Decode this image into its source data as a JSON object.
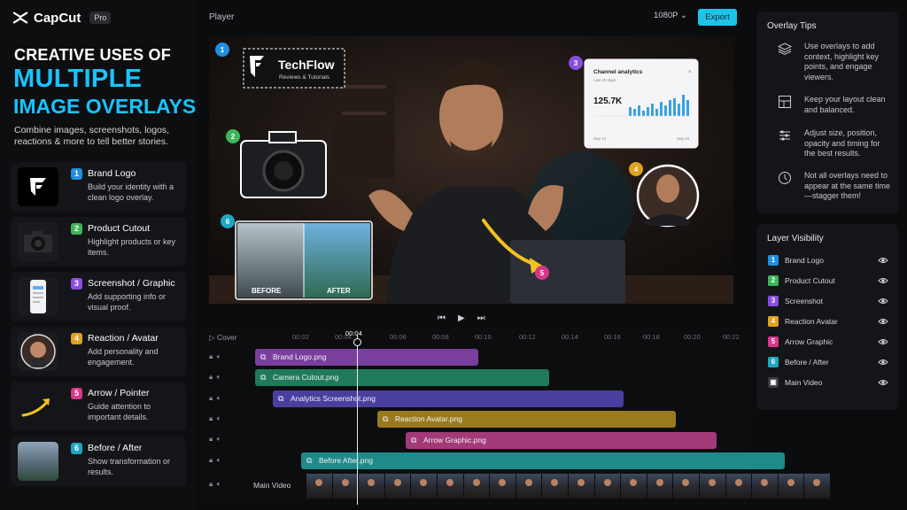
{
  "brand": {
    "name": "CapCut",
    "badge": "Pro"
  },
  "headline": {
    "line1": "CREATIVE USES OF",
    "line2": "MULTIPLE",
    "line3": "IMAGE OVERLAYS",
    "subtitle": "Combine images, screenshots, logos, reactions & more to tell better stories."
  },
  "features": [
    {
      "num": "1",
      "title": "Brand Logo",
      "desc": "Build your identity with a clean logo overlay.",
      "color": "#1f8fe0"
    },
    {
      "num": "2",
      "title": "Product Cutout",
      "desc": "Highlight products or key items.",
      "color": "#3fb55a"
    },
    {
      "num": "3",
      "title": "Screenshot / Graphic",
      "desc": "Add supporting info or visual proof.",
      "color": "#8a4fe0"
    },
    {
      "num": "4",
      "title": "Reaction / Avatar",
      "desc": "Add personality and engagement.",
      "color": "#e0a21f"
    },
    {
      "num": "5",
      "title": "Arrow / Pointer",
      "desc": "Guide attention to important details.",
      "color": "#d8368a"
    },
    {
      "num": "6",
      "title": "Before / After",
      "desc": "Show transformation or results.",
      "color": "#1fa7c2"
    }
  ],
  "player": {
    "label": "Player",
    "resolution": "1080P",
    "export_label": "Export"
  },
  "preview": {
    "logo_title": "TechFlow",
    "logo_subtitle": "Reviews & Tutorials",
    "analytics_title": "Channel analytics",
    "analytics_sub": "Last 28 days",
    "analytics_value": "125.7K",
    "analytics_from": "Sep 12",
    "analytics_to": "Sep 19",
    "before_label": "BEFORE",
    "after_label": "AFTER",
    "markers": [
      "1",
      "2",
      "3",
      "4",
      "5",
      "6"
    ]
  },
  "transport": {
    "prev": "⏮",
    "play": "▶",
    "next": "⏭"
  },
  "timeline": {
    "cover_label": "Cover",
    "playhead_time": "00:04",
    "ticks": [
      "00:02",
      "00:04",
      "00:06",
      "00:08",
      "00:10",
      "00:12",
      "00:14",
      "00:16",
      "00:18",
      "00:20",
      "00:22",
      "00:24"
    ],
    "clips": [
      {
        "name": "Brand Logo.png",
        "color": "#7a3f9e"
      },
      {
        "name": "Camera Cutout.png",
        "color": "#1f7a5a"
      },
      {
        "name": "Analytics Screenshot.png",
        "color": "#4a3f9e"
      },
      {
        "name": "Reaction Avatar.png",
        "color": "#9a7a1f"
      },
      {
        "name": "Arrow Graphic.png",
        "color": "#a33a78"
      },
      {
        "name": "Before After.png",
        "color": "#1f8a8a"
      }
    ],
    "main_video_label": "Main Video"
  },
  "tips": {
    "title": "Overlay Tips",
    "items": [
      {
        "text": "Use overlays to add context, highlight key points, and engage viewers.",
        "icon": "layers-icon"
      },
      {
        "text": "Keep your layout clean and balanced.",
        "icon": "layout-icon"
      },
      {
        "text": "Adjust size, position, opacity and timing for the best results.",
        "icon": "sliders-icon"
      },
      {
        "text": "Not all overlays need to appear at the same time—stagger them!",
        "icon": "clock-icon"
      }
    ]
  },
  "layers": {
    "title": "Layer Visibility",
    "items": [
      {
        "num": "1",
        "name": "Brand Logo",
        "color": "#1f8fe0"
      },
      {
        "num": "2",
        "name": "Product Cutout",
        "color": "#3fb55a"
      },
      {
        "num": "3",
        "name": "Screenshot",
        "color": "#8a4fe0"
      },
      {
        "num": "4",
        "name": "Reaction Avatar",
        "color": "#e0a21f"
      },
      {
        "num": "5",
        "name": "Arrow Graphic",
        "color": "#d8368a"
      },
      {
        "num": "6",
        "name": "Before / After",
        "color": "#1fa7c2"
      },
      {
        "num": "▣",
        "name": "Main Video",
        "color": "#3a3b40"
      }
    ]
  }
}
